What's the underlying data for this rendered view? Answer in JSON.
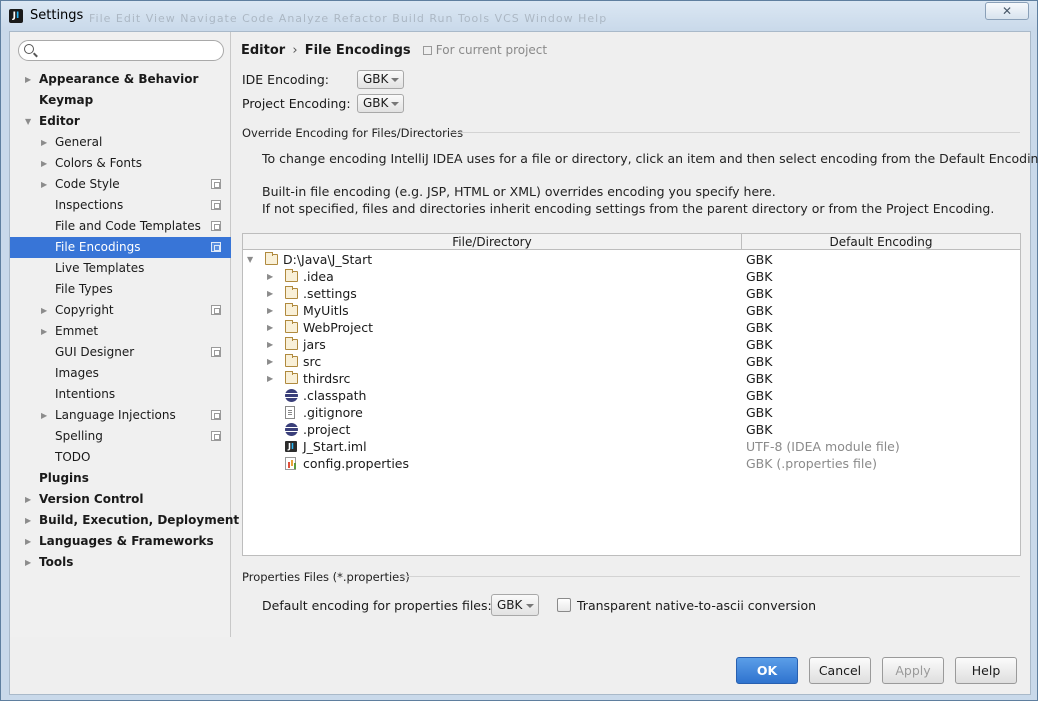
{
  "window": {
    "title": "Settings",
    "close_glyph": "✕",
    "ghost_menu": "File  Edit  View  Navigate  Code  Analyze  Refactor  Build  Run  Tools  VCS  Window  Help"
  },
  "search": {
    "value": "",
    "placeholder": ""
  },
  "sidebar": {
    "items": [
      {
        "label": "Appearance & Behavior",
        "level": 0,
        "bold": true,
        "arrow": "▶",
        "project_icon": false
      },
      {
        "label": "Keymap",
        "level": 0,
        "bold": true,
        "arrow": "",
        "project_icon": false
      },
      {
        "label": "Editor",
        "level": 0,
        "bold": true,
        "arrow": "▼",
        "project_icon": false
      },
      {
        "label": "General",
        "level": 1,
        "bold": false,
        "arrow": "▶",
        "project_icon": false
      },
      {
        "label": "Colors & Fonts",
        "level": 1,
        "bold": false,
        "arrow": "▶",
        "project_icon": false
      },
      {
        "label": "Code Style",
        "level": 1,
        "bold": false,
        "arrow": "▶",
        "project_icon": true
      },
      {
        "label": "Inspections",
        "level": 1,
        "bold": false,
        "arrow": "",
        "project_icon": true
      },
      {
        "label": "File and Code Templates",
        "level": 1,
        "bold": false,
        "arrow": "",
        "project_icon": true
      },
      {
        "label": "File Encodings",
        "level": 1,
        "bold": false,
        "arrow": "",
        "project_icon": true,
        "selected": true
      },
      {
        "label": "Live Templates",
        "level": 1,
        "bold": false,
        "arrow": "",
        "project_icon": false
      },
      {
        "label": "File Types",
        "level": 1,
        "bold": false,
        "arrow": "",
        "project_icon": false
      },
      {
        "label": "Copyright",
        "level": 1,
        "bold": false,
        "arrow": "▶",
        "project_icon": true
      },
      {
        "label": "Emmet",
        "level": 1,
        "bold": false,
        "arrow": "▶",
        "project_icon": false
      },
      {
        "label": "GUI Designer",
        "level": 1,
        "bold": false,
        "arrow": "",
        "project_icon": true
      },
      {
        "label": "Images",
        "level": 1,
        "bold": false,
        "arrow": "",
        "project_icon": false
      },
      {
        "label": "Intentions",
        "level": 1,
        "bold": false,
        "arrow": "",
        "project_icon": false
      },
      {
        "label": "Language Injections",
        "level": 1,
        "bold": false,
        "arrow": "▶",
        "project_icon": true
      },
      {
        "label": "Spelling",
        "level": 1,
        "bold": false,
        "arrow": "",
        "project_icon": true
      },
      {
        "label": "TODO",
        "level": 1,
        "bold": false,
        "arrow": "",
        "project_icon": false
      },
      {
        "label": "Plugins",
        "level": 0,
        "bold": true,
        "arrow": "",
        "project_icon": false
      },
      {
        "label": "Version Control",
        "level": 0,
        "bold": true,
        "arrow": "▶",
        "project_icon": false
      },
      {
        "label": "Build, Execution, Deployment",
        "level": 0,
        "bold": true,
        "arrow": "▶",
        "project_icon": false
      },
      {
        "label": "Languages & Frameworks",
        "level": 0,
        "bold": true,
        "arrow": "▶",
        "project_icon": false
      },
      {
        "label": "Tools",
        "level": 0,
        "bold": true,
        "arrow": "▶",
        "project_icon": false
      }
    ]
  },
  "header": {
    "crumb_parent": "Editor",
    "crumb_separator": "›",
    "crumb_current": "File Encodings",
    "scope_label": "For current project"
  },
  "encodings": {
    "ide_label": "IDE Encoding:",
    "ide_value": "GBK",
    "project_label": "Project Encoding:",
    "project_value": "GBK"
  },
  "override": {
    "section_title": "Override Encoding for Files/Directories",
    "line1": "To change encoding IntelliJ IDEA uses for a file or directory, click an item and then select encoding from the Default Encoding list.",
    "line2": "Built-in file encoding (e.g. JSP, HTML or XML) overrides encoding you specify here.",
    "line3": "If not specified, files and directories inherit encoding settings from the parent directory or from the Project Encoding."
  },
  "table": {
    "columns": [
      "File/Directory",
      "Default Encoding"
    ],
    "rows": [
      {
        "name": "D:\\Java\\J_Start",
        "encoding": "GBK",
        "icon": "folder-icon",
        "arrow": "▼",
        "depth": 0,
        "muted": false
      },
      {
        "name": ".idea",
        "encoding": "GBK",
        "icon": "folder-icon",
        "arrow": "▶",
        "depth": 1,
        "muted": false
      },
      {
        "name": ".settings",
        "encoding": "GBK",
        "icon": "folder-icon",
        "arrow": "▶",
        "depth": 1,
        "muted": false
      },
      {
        "name": "MyUitls",
        "encoding": "GBK",
        "icon": "folder-icon",
        "arrow": "▶",
        "depth": 1,
        "muted": false
      },
      {
        "name": "WebProject",
        "encoding": "GBK",
        "icon": "folder-icon",
        "arrow": "▶",
        "depth": 1,
        "muted": false
      },
      {
        "name": "jars",
        "encoding": "GBK",
        "icon": "folder-icon",
        "arrow": "▶",
        "depth": 1,
        "muted": false
      },
      {
        "name": "src",
        "encoding": "GBK",
        "icon": "folder-icon",
        "arrow": "▶",
        "depth": 1,
        "muted": false
      },
      {
        "name": "thirdsrc",
        "encoding": "GBK",
        "icon": "folder-icon",
        "arrow": "▶",
        "depth": 1,
        "muted": false
      },
      {
        "name": ".classpath",
        "encoding": "GBK",
        "icon": "eclipse-icon",
        "arrow": "",
        "depth": 1,
        "muted": false
      },
      {
        "name": ".gitignore",
        "encoding": "GBK",
        "icon": "file-icon",
        "arrow": "",
        "depth": 1,
        "muted": false
      },
      {
        "name": ".project",
        "encoding": "GBK",
        "icon": "eclipse-icon",
        "arrow": "",
        "depth": 1,
        "muted": false
      },
      {
        "name": "J_Start.iml",
        "encoding": "UTF-8 (IDEA module file)",
        "icon": "iml-icon",
        "arrow": "",
        "depth": 1,
        "muted": true
      },
      {
        "name": "config.properties",
        "encoding": "GBK (.properties file)",
        "icon": "properties-file-icon",
        "arrow": "",
        "depth": 1,
        "muted": true
      }
    ]
  },
  "properties": {
    "section_title": "Properties Files (*.properties)",
    "default_label": "Default encoding for properties files:",
    "default_value": "GBK",
    "transparent_label": "Transparent native-to-ascii conversion",
    "transparent_checked": false
  },
  "buttons": {
    "ok": "OK",
    "cancel": "Cancel",
    "apply": "Apply",
    "help": "Help"
  },
  "colors": {
    "selection": "#3875d7",
    "primary_button": "#2f73cf"
  }
}
